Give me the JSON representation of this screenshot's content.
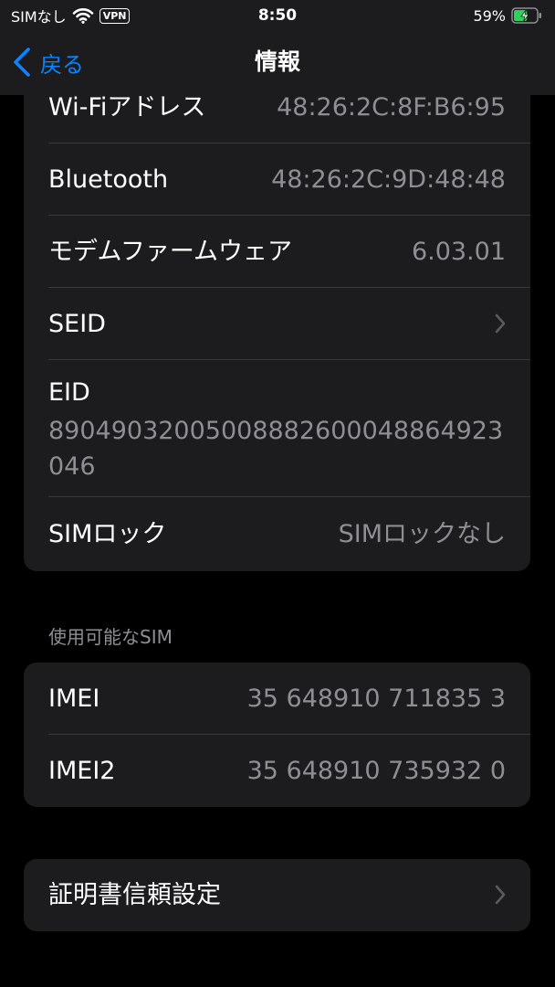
{
  "status_bar": {
    "carrier": "SIMなし",
    "vpn": "VPN",
    "time": "8:50",
    "battery": "59%",
    "battery_level": 59
  },
  "nav": {
    "back_label": "戻る",
    "title": "情報"
  },
  "about": {
    "rows": [
      {
        "label": "Wi-Fiアドレス",
        "value": "48:26:2C:8F:B6:95"
      },
      {
        "label": "Bluetooth",
        "value": "48:26:2C:9D:48:48"
      },
      {
        "label": "モデムファームウェア",
        "value": "6.03.01"
      },
      {
        "label": "SEID",
        "value": ""
      },
      {
        "label": "EID",
        "value": "89049032005008882600048864923046"
      },
      {
        "label": "SIMロック",
        "value": "SIMロックなし"
      }
    ]
  },
  "sim_section": {
    "header": "使用可能なSIM",
    "rows": [
      {
        "label": "IMEI",
        "value": "35 648910 711835 3"
      },
      {
        "label": "IMEI2",
        "value": "35 648910 735932 0"
      }
    ]
  },
  "cert": {
    "label": "証明書信頼設定"
  },
  "colors": {
    "accent": "#0a84ff",
    "background": "#000000",
    "cell": "#1c1c1e",
    "secondary_text": "#8e8e93",
    "separator": "#38383a",
    "battery_fill": "#30d158"
  }
}
